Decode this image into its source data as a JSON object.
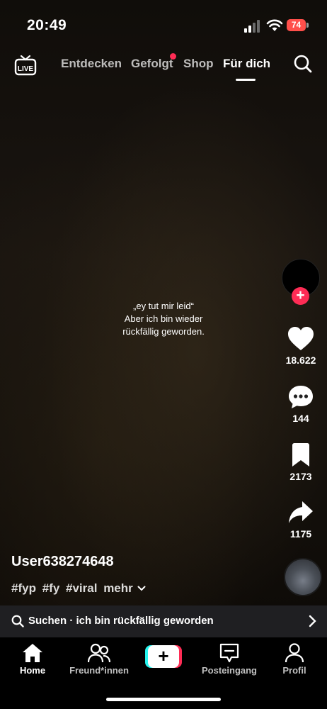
{
  "status_bar": {
    "time": "20:49",
    "battery": "74"
  },
  "top_nav": {
    "tabs": [
      {
        "label": "Entdecken",
        "active": false
      },
      {
        "label": "Gefolgt",
        "active": false,
        "badge_dot": true
      },
      {
        "label": "Shop",
        "active": false
      },
      {
        "label": "Für dich",
        "active": true
      }
    ],
    "live_icon": "live-tv-icon",
    "search_icon": "search-icon"
  },
  "video": {
    "caption_lines": [
      "„ey tut mir leid“",
      "Aber ich bin wieder",
      "rückfällig geworden."
    ]
  },
  "actions": {
    "likes": "18.622",
    "comments": "144",
    "bookmarks": "2173",
    "shares": "1175"
  },
  "post": {
    "username": "User638274648",
    "hashtags": [
      "#fyp",
      "#fy",
      "#viral"
    ],
    "more_label": "mehr"
  },
  "search_suggestion": {
    "text": "Suchen · ich bin rückfällig geworden"
  },
  "bottom_nav": {
    "items": [
      {
        "label": "Home",
        "icon": "home-icon",
        "active": true
      },
      {
        "label": "Freund*innen",
        "icon": "friends-icon",
        "active": false
      },
      {
        "label": "Posteingang",
        "icon": "inbox-icon",
        "active": false
      },
      {
        "label": "Profil",
        "icon": "profile-icon",
        "active": false
      }
    ],
    "create_icon": "plus-icon"
  },
  "colors": {
    "accent": "#fe2c55",
    "cyan": "#25f4ee"
  }
}
